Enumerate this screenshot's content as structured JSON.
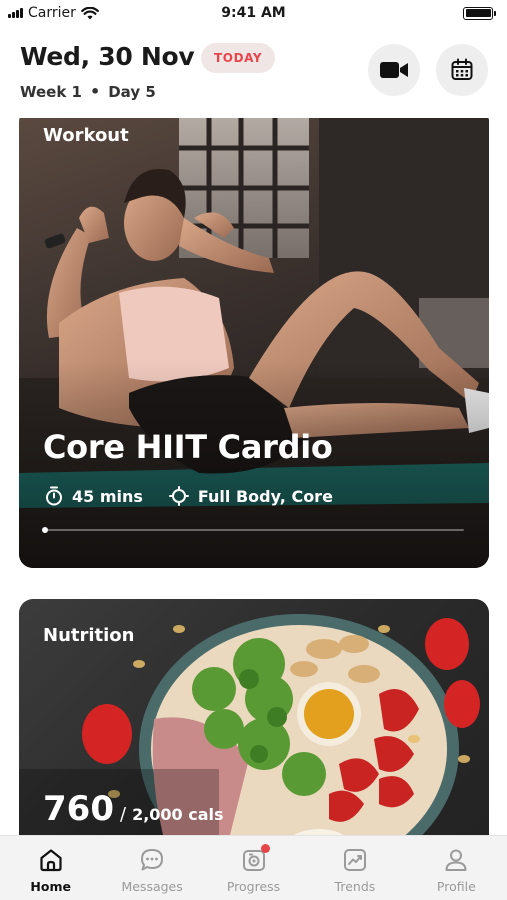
{
  "status_bar": {
    "carrier": "Carrier",
    "time": "9:41 AM"
  },
  "header": {
    "date": "Wed, 30 Nov",
    "today_badge": "TODAY",
    "week": "Week 1",
    "separator": "•",
    "day": "Day 5",
    "video_icon": "video-camera-icon",
    "calendar_icon": "calendar-icon"
  },
  "workout": {
    "label": "Workout",
    "title": "Core HIIT Cardio",
    "duration": "45 mins",
    "focus": "Full Body, Core",
    "progress": 0.0
  },
  "nutrition": {
    "label": "Nutrition",
    "calories": "760",
    "separator": "/",
    "target": "2,000 cals"
  },
  "tabs": [
    {
      "label": "Home",
      "icon": "home-icon",
      "active": true
    },
    {
      "label": "Messages",
      "icon": "chat-icon",
      "active": false
    },
    {
      "label": "Progress",
      "icon": "camera-icon",
      "active": false
    },
    {
      "label": "Trends",
      "icon": "trend-chart-icon",
      "active": false
    },
    {
      "label": "Profile",
      "icon": "user-icon",
      "active": false
    }
  ],
  "colors": {
    "accent": "#e8454b",
    "badge_bg": "#f1e6e6",
    "tab_bg": "#f3f3f3"
  }
}
